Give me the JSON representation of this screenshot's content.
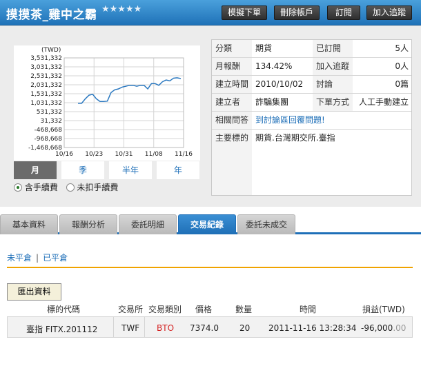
{
  "header": {
    "title": "摸摸茶_雞中之霸",
    "stars": "★★★★★",
    "buttons": [
      "模擬下單",
      "刪除帳戶",
      "訂閱",
      "加入追蹤"
    ]
  },
  "chart_data": {
    "type": "line",
    "unit_label": "(TWD)",
    "y_ticks": [
      "3,531,332",
      "3,031,332",
      "2,531,332",
      "2,031,332",
      "1,531,332",
      "1,031,332",
      "531,332",
      "31,332",
      "-468,668",
      "-968,668",
      "-1,468,668"
    ],
    "y_tick_values": [
      3531332,
      3031332,
      2531332,
      2031332,
      1531332,
      1031332,
      531332,
      31332,
      -468668,
      -968668,
      -1468668
    ],
    "ylim": [
      -1468668,
      3531332
    ],
    "x_ticks": [
      "10/16",
      "10/23",
      "10/31",
      "11/08",
      "11/16"
    ],
    "series": [
      {
        "values": [
          1000000,
          1000000,
          1250000,
          1450000,
          1500000,
          1250000,
          1100000,
          1100000,
          1120000,
          1600000,
          1750000,
          1800000,
          1900000,
          1950000,
          2000000,
          2000000,
          1950000,
          2000000,
          2000000,
          1800000,
          2100000,
          2100000,
          2000000,
          2200000,
          2300000,
          2250000,
          2400000,
          2420000,
          2380000
        ]
      }
    ],
    "line_color": "#2a78c0",
    "grid": true
  },
  "period_tabs": [
    "月",
    "季",
    "半年",
    "年"
  ],
  "fee_options": [
    "含手續費",
    "未扣手續費"
  ],
  "info": {
    "category_label": "分類",
    "category_value": "期貨",
    "subscribed_label": "已訂閱",
    "subscribed_value": "5人",
    "monthly_label": "月報酬",
    "monthly_value": "134.42%",
    "tracking_label": "加入追蹤",
    "tracking_value": "0人",
    "created_label": "建立時間",
    "created_value": "2010/10/02",
    "discuss_label": "討論",
    "discuss_value": "0篇",
    "creator_label": "建立者",
    "creator_value": "詐騙集團",
    "order_label": "下單方式",
    "order_value": "人工手動建立",
    "qa_label": "相關問答",
    "qa_value": "到討論區回覆問題!",
    "target_label": "主要標的",
    "target_value": "期貨.台灣期交所.臺指"
  },
  "tabs": [
    "基本資料",
    "報酬分析",
    "委託明細",
    "交易紀錄",
    "委託未成交"
  ],
  "subnav": [
    "未平倉",
    "已平倉"
  ],
  "export_label": "匯出資料",
  "table": {
    "headers": [
      "標的代碼",
      "交易所",
      "交易類別",
      "價格",
      "數量",
      "時間",
      "損益(TWD)"
    ],
    "row": {
      "symbol": "臺指 FITX.201112",
      "exchange": "TWF",
      "type": "BTO",
      "price": "7374.0",
      "qty": "20",
      "time": "2011-11-16 13:28:34",
      "pnl_main": "-96,000",
      "pnl_dec": ".00"
    }
  },
  "colors": {
    "accent": "#1e6fb8",
    "bto": "#d42020",
    "orange": "#f0a300"
  }
}
